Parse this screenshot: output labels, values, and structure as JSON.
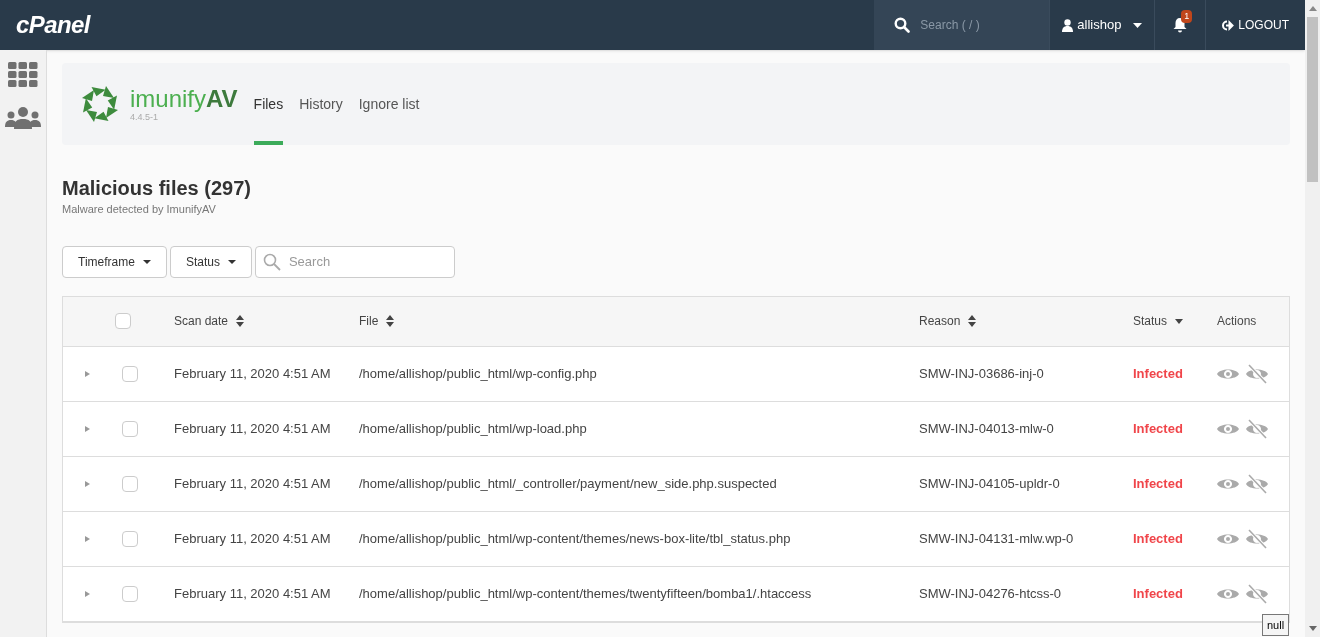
{
  "topbar": {
    "logo": "cPanel",
    "search": {
      "placeholder": "Search ( / )"
    },
    "user": "allishop",
    "notifications": "1",
    "logout": "LOGOUT"
  },
  "plugin": {
    "name": "imunify",
    "name_suffix": "AV",
    "version": "4.4.5-1"
  },
  "tabs": [
    {
      "label": "Files",
      "selected": true
    },
    {
      "label": "History",
      "selected": false
    },
    {
      "label": "Ignore list",
      "selected": false
    }
  ],
  "page": {
    "title": "Malicious files (297)",
    "subtitle": "Malware detected by ImunifyAV"
  },
  "filters": [
    {
      "label": "Timeframe"
    },
    {
      "label": "Status"
    }
  ],
  "search": {
    "placeholder": "Search"
  },
  "table": {
    "select_all": {
      "checked": false
    },
    "columns": [
      {
        "label": "Scan date",
        "sortable": true,
        "sorted": false
      },
      {
        "label": "File",
        "sortable": true,
        "sorted": false
      },
      {
        "label": "Reason",
        "sortable": true,
        "sorted": false
      },
      {
        "label": "Status",
        "sortable": true,
        "sorted": true
      },
      {
        "label": "Actions",
        "sortable": false,
        "sorted": false
      }
    ],
    "rows": [
      {
        "scan_date": "February 11, 2020 4:51 AM",
        "file": "/home/allishop/public_html/wp-config.php",
        "reason": "SMW-INJ-03686-inj-0",
        "status": "Infected",
        "checked": false,
        "expanded": false
      },
      {
        "scan_date": "February 11, 2020 4:51 AM",
        "file": "/home/allishop/public_html/wp-load.php",
        "reason": "SMW-INJ-04013-mlw-0",
        "status": "Infected",
        "checked": false,
        "expanded": false
      },
      {
        "scan_date": "February 11, 2020 4:51 AM",
        "file": "/home/allishop/public_html/_controller/payment/new_side.php.suspected",
        "reason": "SMW-INJ-04105-upldr-0",
        "status": "Infected",
        "checked": false,
        "expanded": false
      },
      {
        "scan_date": "February 11, 2020 4:51 AM",
        "file": "/home/allishop/public_html/wp-content/themes/news-box-lite/tbl_status.php",
        "reason": "SMW-INJ-04131-mlw.wp-0",
        "status": "Infected",
        "checked": false,
        "expanded": false
      },
      {
        "scan_date": "February 11, 2020 4:51 AM",
        "file": "/home/allishop/public_html/wp-content/themes/twentyfifteen/bomba1/.htaccess",
        "reason": "SMW-INJ-04276-htcss-0",
        "status": "Infected",
        "checked": false,
        "expanded": false
      }
    ]
  },
  "tooltip": "null"
}
